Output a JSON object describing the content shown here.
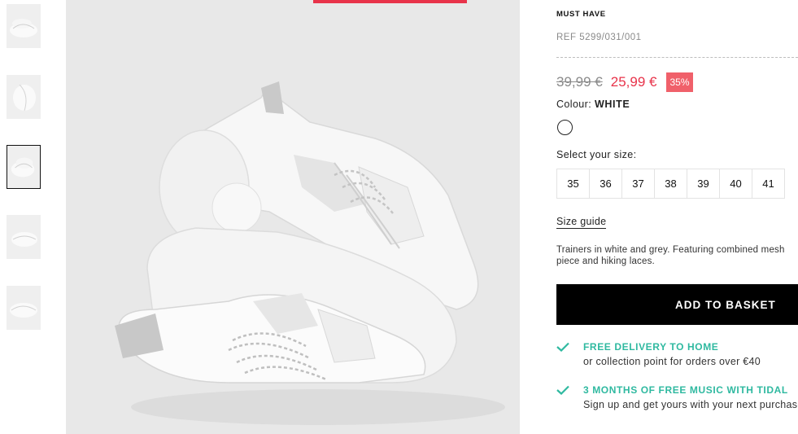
{
  "product": {
    "tag": "MUST HAVE",
    "reference": "REF 5299/031/001",
    "old_price": "39,99 €",
    "new_price": "25,99 €",
    "discount": "35%",
    "colour_label": "Colour:",
    "colour_value": "WHITE",
    "size_label": "Select your size:",
    "sizes": [
      "35",
      "36",
      "37",
      "38",
      "39",
      "40",
      "41"
    ],
    "size_guide": "Size guide",
    "description": "Trainers in white and grey. Featuring combined mesh piece and hiking laces.",
    "add_to_basket": "ADD TO BASKET",
    "benefits": [
      {
        "title": "FREE DELIVERY TO HOME",
        "subtitle": "or collection point for orders over €40"
      },
      {
        "title": "3 MONTHS OF FREE MUSIC WITH TIDAL",
        "subtitle": "Sign up and get yours with your next purchase"
      }
    ],
    "colors": {
      "accent": "#e8334a",
      "discount_bg": "#f0606a",
      "benefit": "#2fb9a0"
    }
  }
}
